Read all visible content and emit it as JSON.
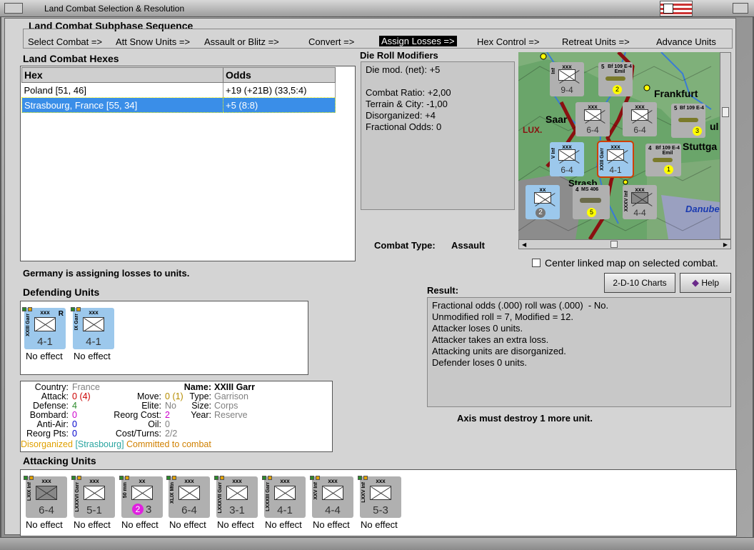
{
  "window": {
    "title": "Land Combat Selection & Resolution"
  },
  "subphase": {
    "title": "Land Combat Subphase Sequence",
    "steps": [
      "Select Combat =>",
      "Att Snow Units =>",
      "Assault or Blitz =>",
      "Convert =>",
      "Assign Losses =>",
      "Hex Control =>",
      "Retreat Units =>",
      "Advance Units"
    ],
    "active_step": "Assign Losses =>"
  },
  "hexes": {
    "title": "Land Combat Hexes",
    "columns": [
      "Hex",
      "Odds"
    ],
    "rows": [
      {
        "hex": "Poland [51, 46]",
        "odds": "+19 (+21B) (33,5:4)"
      },
      {
        "hex": "Strasbourg, France [55, 34]",
        "odds": "+5 (8:8)"
      }
    ]
  },
  "die_roll": {
    "title": "Die Roll Modifiers",
    "lines": [
      "Die mod. (net): +5",
      "",
      "Combat Ratio: +2,00",
      "Terrain & City: -1,00",
      "Disorganized: +4",
      "Fractional Odds: 0"
    ]
  },
  "combat_type": {
    "label": "Combat Type:",
    "value": "Assault"
  },
  "map": {
    "labels": [
      "Frankfurt",
      "Saar",
      "LUX.",
      "Stuttga",
      "Strasb",
      "Danube",
      "ul"
    ],
    "units": [
      {
        "name": "Inf",
        "value": "9-4",
        "size": "xxx",
        "kind": "gray"
      },
      {
        "name": "Bf 109 E-4 Emil",
        "value": "2",
        "size": "5",
        "kind": "air"
      },
      {
        "name": "Bf 109 E-4",
        "value": "3",
        "size": "5",
        "kind": "air"
      },
      {
        "name": "",
        "value": "6-4",
        "size": "xxx",
        "kind": "gray"
      },
      {
        "name": "",
        "value": "6-4",
        "size": "xxx",
        "kind": "gray"
      },
      {
        "name": "V Inf",
        "value": "6-4",
        "size": "xxx",
        "kind": "blue"
      },
      {
        "name": "XXIII Garr",
        "value": "4-1",
        "size": "xxx",
        "kind": "blue"
      },
      {
        "name": "Bf 109 E-4 Emil",
        "value": "1",
        "size": "4",
        "kind": "air"
      },
      {
        "name": "",
        "value": "2",
        "size": "xx",
        "kind": "blue"
      },
      {
        "name": "MS 406",
        "value": "5",
        "size": "4",
        "kind": "air"
      },
      {
        "name": "XXXV Inf",
        "value": "4-4",
        "size": "xxx",
        "kind": "gray"
      }
    ]
  },
  "center_map": {
    "label": "Center linked map on selected combat.",
    "checked": false
  },
  "status_message": "Germany is assigning losses to units.",
  "buttons": {
    "charts": "2-D-10 Charts",
    "help": "Help"
  },
  "defending": {
    "title": "Defending Units",
    "units": [
      {
        "name": "XXIII Garr",
        "value": "4-1",
        "size": "xxx",
        "mark": "R",
        "effect": "No effect"
      },
      {
        "name": "IX Garr",
        "value": "4-1",
        "size": "xxx",
        "mark": "",
        "effect": "No effect"
      }
    ]
  },
  "unit_info": {
    "country_label": "Country:",
    "country": "France",
    "attack_label": "Attack:",
    "attack": "0",
    "attack_extra": "(4)",
    "defense_label": "Defense:",
    "defense": "4",
    "bombard_label": "Bombard:",
    "bombard": "0",
    "antiair_label": "Anti-Air:",
    "antiair": "0",
    "reorg_label": "Reorg Pts:",
    "reorg_pts": "0",
    "name_label": "Name:",
    "name": "XXIII Garr",
    "move_label": "Move:",
    "move": "0",
    "move_extra": "(1)",
    "elite_label": "Elite:",
    "elite": "No",
    "reorg_cost_label": "Reorg Cost:",
    "reorg_cost": "2",
    "oil_label": "Oil:",
    "oil": "0",
    "cost_label": "Cost/Turns:",
    "cost": "2/2",
    "type_label": "Type:",
    "type": "Garrison",
    "size_label": "Size:",
    "size": "Corps",
    "year_label": "Year:",
    "year": "Reserve",
    "status_disorganized": "Disorganized",
    "status_location": "[Strasbourg]",
    "status_committed": "Committed to combat"
  },
  "result": {
    "title": "Result:",
    "lines": [
      "Fractional odds (.000) roll was (.000)  - No.",
      "Unmodified roll = 7, Modified = 12.",
      "Attacker loses 0 units.",
      "Attacker takes an extra loss.",
      "Attacking units are disorganized.",
      "Defender loses 0 units."
    ],
    "footer": "Axis must destroy 1 more unit."
  },
  "attacking": {
    "title": "Attacking Units",
    "units": [
      {
        "name": "LXIX Inf",
        "value": "6-4",
        "size": "xxx",
        "effect": "No effect"
      },
      {
        "name": "LXXXVI Garr",
        "value": "5-1",
        "size": "xxx",
        "effect": "No effect"
      },
      {
        "name": "50 mm",
        "value": "3",
        "badge": "2",
        "size": "xx",
        "effect": "No effect"
      },
      {
        "name": "XLIX Mtn",
        "value": "6-4",
        "size": "xxx",
        "effect": "No effect"
      },
      {
        "name": "LXXXVII Garr",
        "value": "3-1",
        "size": "xxx",
        "effect": "No effect"
      },
      {
        "name": "LXXXIII Garr",
        "value": "4-1",
        "size": "xxx",
        "effect": "No effect"
      },
      {
        "name": "XXV Inf",
        "value": "4-4",
        "size": "xxx",
        "effect": "No effect"
      },
      {
        "name": "LXXV Inf",
        "value": "5-3",
        "size": "xxx",
        "effect": "No effect"
      }
    ]
  }
}
